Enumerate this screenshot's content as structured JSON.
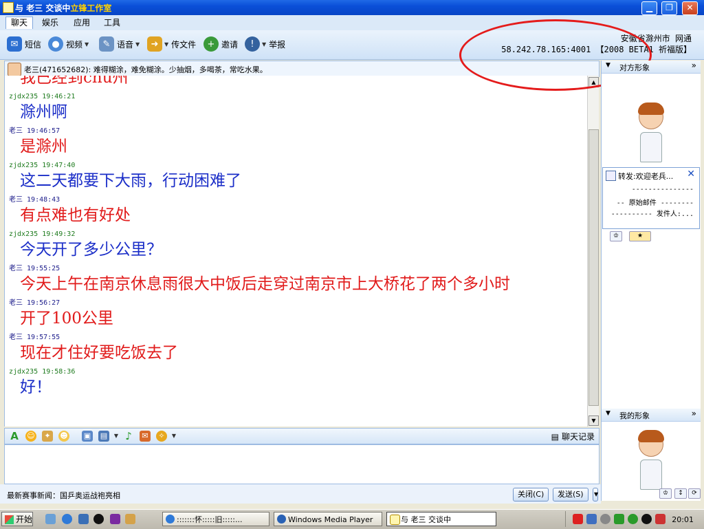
{
  "window": {
    "title": "与 老三 交谈中",
    "title_suffix": "立锋工作室",
    "minimize": "▁",
    "maximize": "❐",
    "close": "✕"
  },
  "menu_tabs": [
    "聊天",
    "娱乐",
    "应用",
    "工具"
  ],
  "toolbar": {
    "sms": "短信",
    "video": "视频",
    "voice": "语音",
    "file": "传文件",
    "invite": "邀请",
    "report": "举报"
  },
  "location": {
    "line1": "安徽省滁州市 网通",
    "line2": "58.242.78.165:4001 【2008 BETA1 祈福版】"
  },
  "contact": {
    "signature": "老三(471652682): 难得糊涂，难免糊涂。少抽烟，多喝茶，常吃水果。"
  },
  "messages": [
    {
      "sender": "",
      "time": "",
      "text": "我已经到chu州",
      "who": "other"
    },
    {
      "sender": "zjdx235",
      "time": "19:46:21",
      "text": "滁州啊",
      "who": "me"
    },
    {
      "sender": "老三",
      "time": "19:46:57",
      "text": "是滁州",
      "who": "other"
    },
    {
      "sender": "zjdx235",
      "time": "19:47:40",
      "text": "这二天都要下大雨，行动困难了",
      "who": "me"
    },
    {
      "sender": "老三",
      "time": "19:48:43",
      "text": "有点难也有好处",
      "who": "other"
    },
    {
      "sender": "zjdx235",
      "time": "19:49:32",
      "text": "今天开了多少公里？",
      "who": "me"
    },
    {
      "sender": "老三",
      "time": "19:55:25",
      "text": "今天上午在南京休息雨很大中饭后走穿过南京市上大桥花了两个多小时",
      "who": "other"
    },
    {
      "sender": "老三",
      "time": "19:56:27",
      "text": "开了100公里",
      "who": "other"
    },
    {
      "sender": "老三",
      "time": "19:57:55",
      "text": "现在才住好要吃饭去了",
      "who": "other"
    },
    {
      "sender": "zjdx235",
      "time": "19:58:36",
      "text": "好！",
      "who": "me"
    }
  ],
  "input_toolbar": {
    "history": "聊天记录"
  },
  "bottom": {
    "news": "最新赛事新闻：国乒奥运战袍亮相",
    "close_btn": "关闭(C)",
    "send_btn": "发送(S)"
  },
  "right_panel": {
    "other_title": "对方形象",
    "my_title": "我的形象",
    "popup_title": "转发:欢迎老兵...",
    "popup_lines": [
      "---------------",
      "-- 原始邮件 --------",
      "---------- 发件人:..."
    ]
  },
  "taskbar": {
    "start": "开始",
    "tasks": [
      {
        "label": ":::::::怀:::::旧:::::..."
      },
      {
        "label": "Windows Media Player"
      },
      {
        "label": "与 老三 交谈中"
      }
    ],
    "clock": "20:01"
  },
  "colors": {
    "my_text": "#1b2ec8",
    "other_text": "#e11a1a",
    "annotation": "#e41b1b"
  }
}
